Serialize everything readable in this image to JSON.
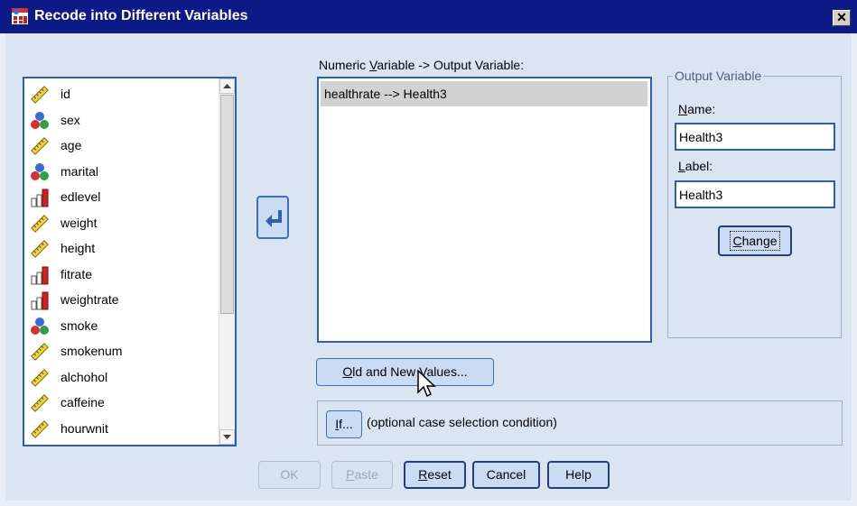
{
  "window": {
    "title": "Recode into Different Variables",
    "close_glyph": "✕"
  },
  "variables": [
    {
      "name": "id",
      "icon": "scale-ruler-icon"
    },
    {
      "name": "sex",
      "icon": "nominal-balls-icon"
    },
    {
      "name": "age",
      "icon": "scale-ruler-icon"
    },
    {
      "name": "marital",
      "icon": "nominal-balls-icon"
    },
    {
      "name": "edlevel",
      "icon": "ordinal-bars-icon"
    },
    {
      "name": "weight",
      "icon": "scale-ruler-icon"
    },
    {
      "name": "height",
      "icon": "scale-ruler-icon"
    },
    {
      "name": "fitrate",
      "icon": "ordinal-bars-icon"
    },
    {
      "name": "weightrate",
      "icon": "ordinal-bars-icon"
    },
    {
      "name": "smoke",
      "icon": "nominal-balls-icon"
    },
    {
      "name": "smokenum",
      "icon": "scale-ruler-icon"
    },
    {
      "name": "alchohol",
      "icon": "scale-ruler-icon"
    },
    {
      "name": "caffeine",
      "icon": "scale-ruler-icon"
    },
    {
      "name": "hourwnit",
      "icon": "scale-ruler-icon"
    }
  ],
  "mapping": {
    "header_pre": "Numeric ",
    "header_u": "V",
    "header_post": "ariable -> Output Variable:",
    "items": [
      "healthrate --> Health3"
    ]
  },
  "output": {
    "legend": "Output Variable",
    "name_u": "N",
    "name_rest": "ame:",
    "name_value": "Health3",
    "label_u": "L",
    "label_rest": "abel:",
    "label_value": "Health3",
    "change_u": "C",
    "change_rest": "hange"
  },
  "old_new": {
    "u": "O",
    "rest": "ld and New Values..."
  },
  "if": {
    "u": "I",
    "rest": "f...",
    "caption": "(optional case selection condition)"
  },
  "buttons": {
    "ok": "OK",
    "paste_u": "P",
    "paste_rest": "aste",
    "reset_u": "R",
    "reset_rest": "eset",
    "cancel": "Cancel",
    "help": "Help"
  },
  "colors": {
    "title_bar": "#0b1a86",
    "dialog_bg": "#dbe5f1",
    "button_bg": "#c9dcf4",
    "list_border": "#2f5fa8"
  }
}
